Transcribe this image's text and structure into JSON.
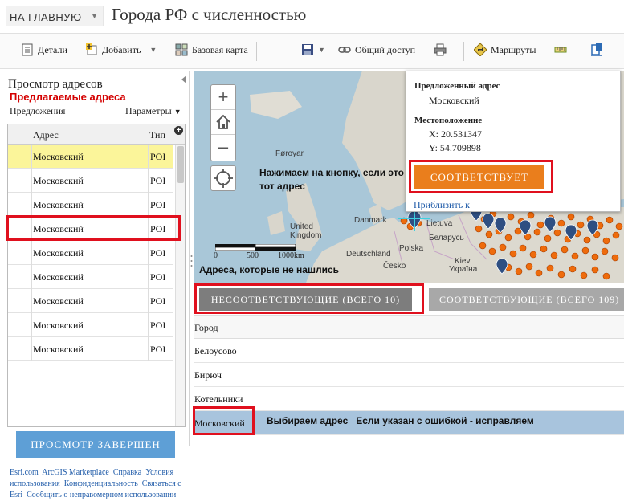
{
  "header": {
    "home_label": "НА ГЛАВНУЮ",
    "title": "Города РФ с численностью"
  },
  "toolbar": {
    "details": "Детали",
    "add": "Добавить",
    "basemap": "Базовая карта",
    "share": "Общий доступ",
    "routes": "Маршруты"
  },
  "left_panel": {
    "title": "Просмотр адресов",
    "subtitle": "Предлагаемые адреса",
    "suggestions_label": "Предложения",
    "params_label": "Параметры",
    "columns": [
      "Адрес",
      "Тип"
    ],
    "rows": [
      {
        "address": "Московский",
        "type": "POI"
      },
      {
        "address": "Московский",
        "type": "POI"
      },
      {
        "address": "Московский",
        "type": "POI"
      },
      {
        "address": "Московский",
        "type": "POI"
      },
      {
        "address": "Московский",
        "type": "POI"
      },
      {
        "address": "Московский",
        "type": "POI"
      },
      {
        "address": "Московский",
        "type": "POI"
      },
      {
        "address": "Московский",
        "type": "POI"
      },
      {
        "address": "Московский",
        "type": "POI"
      }
    ],
    "done_button": "ПРОСМОТР ЗАВЕРШЕН",
    "footer_links": [
      "Esri.com",
      "ArcGIS Marketplace",
      "Справка",
      "Условия использования",
      "Конфиденциальность",
      "Связаться с Esri",
      "Сообщить о неправомерном использовании"
    ]
  },
  "map": {
    "note_button": "Нажимаем на кнопку, если это тот адрес",
    "note_unmatched": "Адреса, которые не нашлись",
    "scale": {
      "l0": "0",
      "l1": "500",
      "l2": "1000km"
    },
    "labels": {
      "faroe": "Føroyar",
      "uk": "United Kingdom",
      "denmark": "Danmark",
      "polska": "Polska",
      "belarus": "Беларусь",
      "kiev": "Kiev",
      "ukraine": "Україна",
      "lietuva": "Lietuva",
      "cesko": "Česko",
      "deutschland": "Deutschland"
    }
  },
  "popup": {
    "suggested_label": "Предложенный адрес",
    "suggested_value": "Московский",
    "location_label": "Местоположение",
    "x": "X: 20.531347",
    "y": "Y: 54.709898",
    "match_button": "СООТВЕТСТВУЕТ",
    "zoom_link": "Приблизить к"
  },
  "tabs": {
    "unmatched": "НЕСООТВЕТСТВУЮЩИЕ (ВСЕГО 10)",
    "matched": "СООТВЕТСТВУЮЩИЕ (ВСЕГО 109)"
  },
  "results": {
    "header": "Город",
    "rows": [
      "Белоусово",
      "Бирюч",
      "Котельники",
      "Московский"
    ],
    "note": "Выбираем адрес   Если указан с ошибкой - исправляем"
  },
  "colors": {
    "accent_orange": "#ea7e1c",
    "accent_blue": "#5e9fd6",
    "highlight_red": "#e0101e",
    "selected_row": "#fbf59a",
    "selected_result": "#a8c4dd"
  }
}
